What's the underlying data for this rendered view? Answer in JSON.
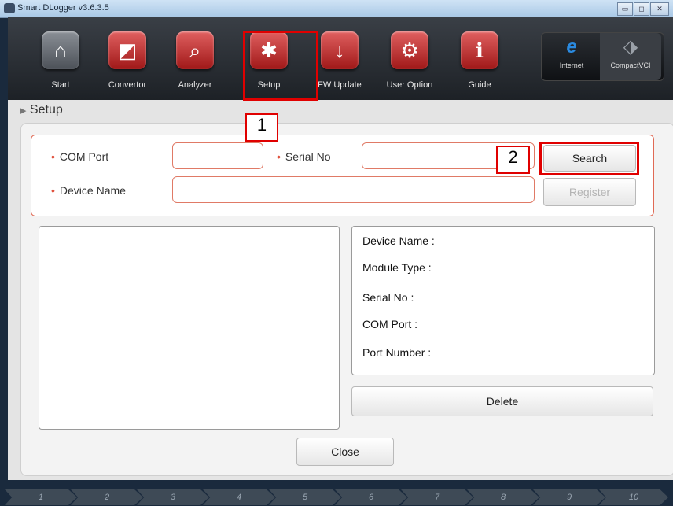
{
  "window": {
    "title": "Smart DLogger v3.6.3.5",
    "buttons": [
      "▭",
      "◻",
      "✕"
    ]
  },
  "toolbar": {
    "items": [
      {
        "label": "Start",
        "icon": "home-icon",
        "glyph": "⌂"
      },
      {
        "label": "Convertor",
        "icon": "convertor-icon",
        "glyph": "◩"
      },
      {
        "label": "Analyzer",
        "icon": "analyzer-icon",
        "glyph": "⌕"
      },
      {
        "label": "Setup",
        "icon": "setup-icon",
        "glyph": "✱"
      },
      {
        "label": "FW Update",
        "icon": "fw-update-icon",
        "glyph": "↓"
      },
      {
        "label": "User Option",
        "icon": "user-option-icon",
        "glyph": "⚙"
      },
      {
        "label": "Guide",
        "icon": "guide-icon",
        "glyph": "ℹ"
      }
    ],
    "web": [
      {
        "label": "Internet",
        "icon": "internet-icon",
        "glyph": "e"
      },
      {
        "label": "CompactVCI",
        "icon": "compactvci-icon",
        "glyph": "⬗"
      }
    ]
  },
  "annotations": {
    "step1": "1",
    "step2": "2",
    "highlight_color": "#e00000"
  },
  "section": {
    "title": "Setup",
    "arrow": "▶"
  },
  "form": {
    "com_port_label": "COM Port",
    "com_port_value": "",
    "serial_no_label": "Serial No",
    "serial_no_value": "",
    "device_name_label": "Device Name",
    "device_name_value": "",
    "search_label": "Search",
    "register_label": "Register",
    "bullet": "•"
  },
  "info": {
    "device_name": "Device Name :",
    "module_type": "Module Type :",
    "serial_no": "Serial No :",
    "com_port": "COM Port :",
    "port_number": "Port Number :"
  },
  "actions": {
    "delete_label": "Delete",
    "close_label": "Close"
  },
  "steps": [
    "1",
    "2",
    "3",
    "4",
    "5",
    "6",
    "7",
    "8",
    "9",
    "10"
  ],
  "colors": {
    "accent": "#e06a55",
    "toolbar_bg": "#2a2e33",
    "icon_red": "#c02828"
  }
}
